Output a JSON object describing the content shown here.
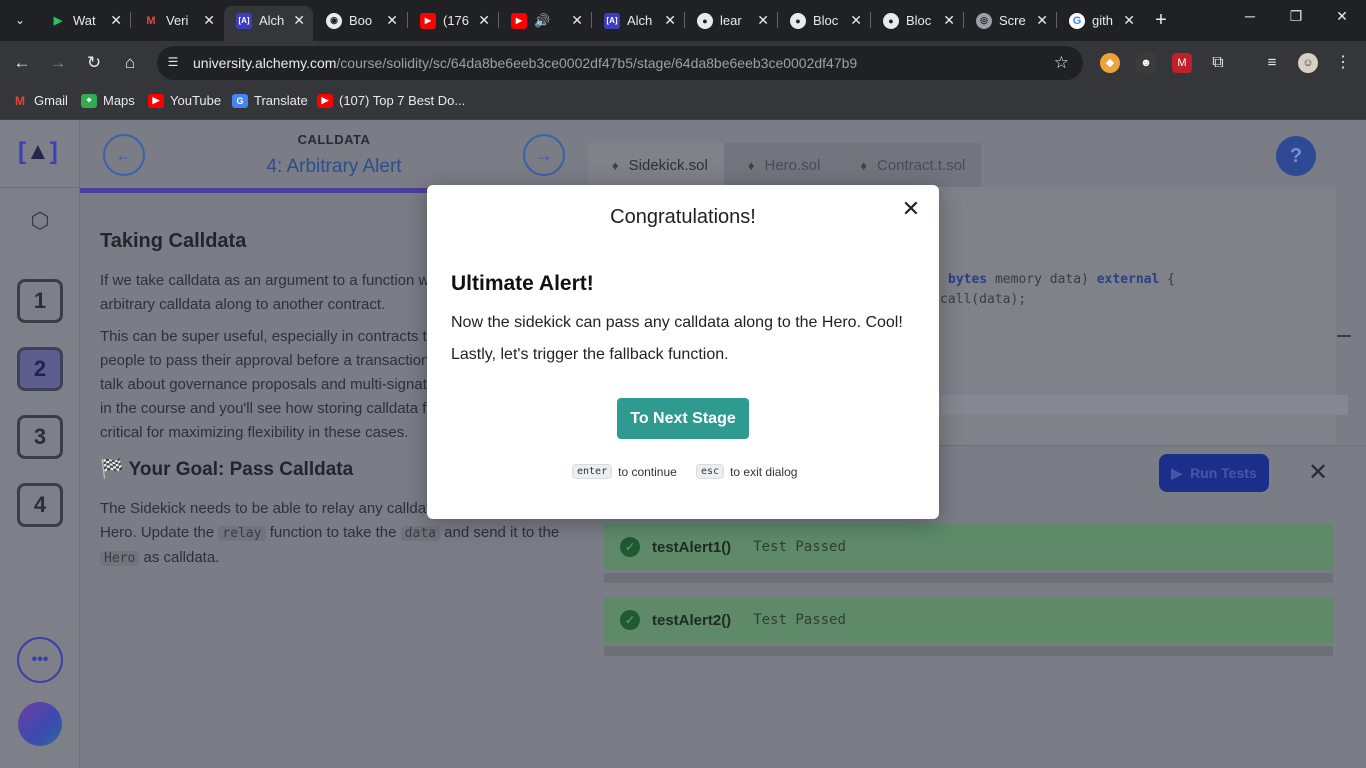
{
  "browser": {
    "tabs": [
      {
        "label": "Wat",
        "icon": "play-icon",
        "color": "#22c55e"
      },
      {
        "label": "Veri",
        "icon": "gmail-icon",
        "color": "#ea4335"
      },
      {
        "label": "Alch",
        "icon": "alchemy-icon",
        "color": "#3b3fbd"
      },
      {
        "label": "Boo",
        "icon": "bot-icon",
        "color": "#e8eaed"
      },
      {
        "label": "(176",
        "icon": "youtube-icon",
        "color": "#ff0000"
      },
      {
        "label": "",
        "icon": "youtube-icon",
        "color": "#ff0000"
      },
      {
        "label": "Alch",
        "icon": "alchemy-icon",
        "color": "#3b3fbd"
      },
      {
        "label": "lear",
        "icon": "github-icon",
        "color": "#e8eaed"
      },
      {
        "label": "Bloc",
        "icon": "github-icon",
        "color": "#e8eaed"
      },
      {
        "label": "Bloc",
        "icon": "github-icon",
        "color": "#e8eaed"
      },
      {
        "label": "Scre",
        "icon": "globe-icon",
        "color": "#9aa0a6"
      },
      {
        "label": "gith",
        "icon": "google-icon",
        "color": "#4285f4"
      }
    ],
    "url_host": "university.alchemy.com",
    "url_path": "/course/solidity/sc/64da8be6eeb3ce0002df47b5/stage/64da8be6eeb3ce0002df47b9",
    "bookmarks": [
      "Gmail",
      "Maps",
      "YouTube",
      "Translate",
      "(107) Top 7 Best Do..."
    ]
  },
  "sidebar": {
    "stages": [
      "1",
      "2",
      "3",
      "4"
    ],
    "current_stage": "2",
    "more_label": "•••"
  },
  "lesson": {
    "section": "CALLDATA",
    "stage_title": "4: Arbitrary Alert",
    "heading": "Taking Calldata",
    "para1": "If we take calldata as an argument to a function we can pass that arbitrary calldata along to another contract.",
    "para2": "This can be super useful, especially in contracts that require many people to pass their approval before a transaction is executed. We'll talk about governance proposals and multi-signature wallets later on in the course and you'll see how storing calldata for later use is critical for maximizing flexibility in these cases.",
    "goal_heading": "Your Goal: Pass Calldata",
    "goal_text_1": "The Sidekick needs to be able to relay any calldata along to the Hero. Update the",
    "goal_code_1": "relay",
    "goal_text_2": "function to take the",
    "goal_code_2": "data",
    "goal_text_3": "and send it to the",
    "goal_code_3": "Hero",
    "goal_text_4": "as calldata."
  },
  "editor": {
    "tabs": [
      "Sidekick.sol",
      "Hero.sol",
      "Contract.t.sol"
    ],
    "code_line_1_kw1": "bytes",
    "code_line_1_mid": " memory data) ",
    "code_line_1_kw2": "external",
    "code_line_1_end": " {",
    "code_line_2": "call(data);",
    "help_label": "?",
    "run_tests_label": "Run Tests",
    "tests": [
      {
        "name": "testAlert1()",
        "status": "Test Passed"
      },
      {
        "name": "testAlert2()",
        "status": "Test Passed"
      }
    ]
  },
  "modal": {
    "title": "Congratulations!",
    "heading": "Ultimate Alert!",
    "text1": "Now the sidekick can pass any calldata along to the Hero. Cool!",
    "text2": "Lastly, let's trigger the fallback function.",
    "button": "To Next Stage",
    "hint_enter_key": "enter",
    "hint_enter_text": "to continue",
    "hint_esc_key": "esc",
    "hint_esc_text": "to exit dialog"
  },
  "colors": {
    "accent_teal": "#2f9a8f",
    "test_pass": "#5e8a6a",
    "run_button": "#1b2f8a"
  }
}
